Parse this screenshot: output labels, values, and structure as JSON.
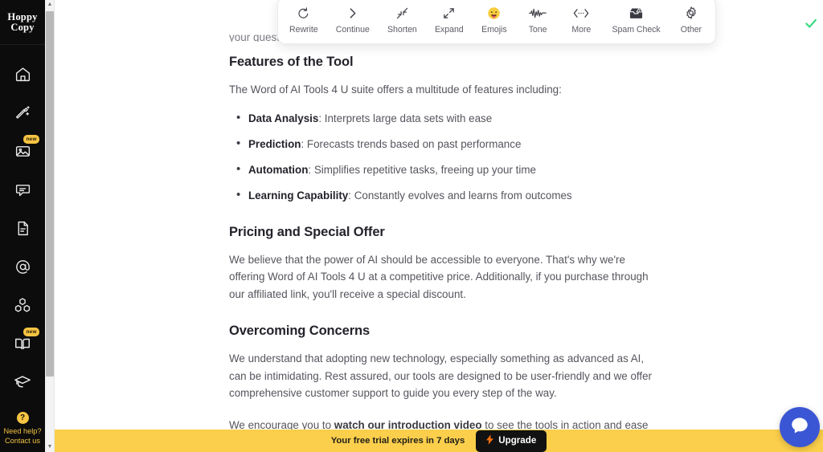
{
  "app": {
    "logo_line1": "Hoppy",
    "logo_line2": "Copy"
  },
  "sidebar": {
    "items": [
      {
        "name": "home",
        "icon": "home-icon",
        "badge": ""
      },
      {
        "name": "magic",
        "icon": "magic-wand-icon",
        "badge": ""
      },
      {
        "name": "images",
        "icon": "image-icon",
        "badge": "new"
      },
      {
        "name": "chat",
        "icon": "chat-bubble-icon",
        "badge": ""
      },
      {
        "name": "documents",
        "icon": "document-icon",
        "badge": ""
      },
      {
        "name": "mentions",
        "icon": "at-sign-icon",
        "badge": ""
      },
      {
        "name": "blocks",
        "icon": "blocks-icon",
        "badge": ""
      },
      {
        "name": "library",
        "icon": "open-book-icon",
        "badge": "new"
      },
      {
        "name": "academy",
        "icon": "graduation-cap-icon",
        "badge": ""
      }
    ],
    "help": {
      "badge": "?",
      "line1": "Need help?",
      "line2": "Contact us"
    }
  },
  "toolbar": {
    "buttons": [
      {
        "label": "Rewrite",
        "icon": "refresh-icon"
      },
      {
        "label": "Continue",
        "icon": "chevron-right-icon"
      },
      {
        "label": "Shorten",
        "icon": "arrows-in-icon"
      },
      {
        "label": "Expand",
        "icon": "arrows-out-icon"
      },
      {
        "label": "Emojis",
        "icon": "smiley-tongue-icon"
      },
      {
        "label": "Tone",
        "icon": "waveform-icon"
      },
      {
        "label": "More",
        "icon": "code-dots-icon"
      },
      {
        "label": "Spam Check",
        "icon": "inbox-warning-icon"
      },
      {
        "label": "Other",
        "icon": "gear-icon"
      }
    ]
  },
  "document": {
    "clipped_line": "your quest for knowledge and efficiency.",
    "section1_heading": "Features of the Tool",
    "section1_intro": "The Word of AI Tools 4 U suite offers a multitude of features including:",
    "features": [
      {
        "term": "Data Analysis",
        "desc": ": Interprets large data sets with ease"
      },
      {
        "term": "Prediction",
        "desc": ": Forecasts trends based on past performance"
      },
      {
        "term": "Automation",
        "desc": ": Simplifies repetitive tasks, freeing up your time"
      },
      {
        "term": "Learning Capability",
        "desc": ": Constantly evolves and learns from outcomes"
      }
    ],
    "section2_heading": "Pricing and Special Offer",
    "section2_body": "We believe that the power of AI should be accessible to everyone. That's why we're offering Word of AI Tools 4 U at a competitive price. Additionally, if you purchase through our affiliated link, you'll receive a special discount.",
    "section3_heading": "Overcoming Concerns",
    "section3_body": "We understand that adopting new technology, especially something as advanced as AI, can be intimidating. Rest assured, our tools are designed to be user-friendly and we offer comprehensive customer support to guide you every step of the way.",
    "section3_para2_before": "We encourage you to ",
    "section3_link": "watch our introduction video",
    "section3_para2_after": " to see the tools in action and ease any concerns you might have."
  },
  "trial_bar": {
    "message": "Your free trial expires in 7 days",
    "upgrade_label": "Upgrade",
    "bolt": "⚡",
    "bar_color": "#fbcf4b",
    "button_color": "#121212",
    "bolt_color": "#f2700f"
  },
  "status": {
    "saved_icon": "green-check-icon",
    "saved_color": "#3ddc84"
  },
  "chat": {
    "icon": "chat-bubble-icon",
    "color": "#3b56d4"
  }
}
